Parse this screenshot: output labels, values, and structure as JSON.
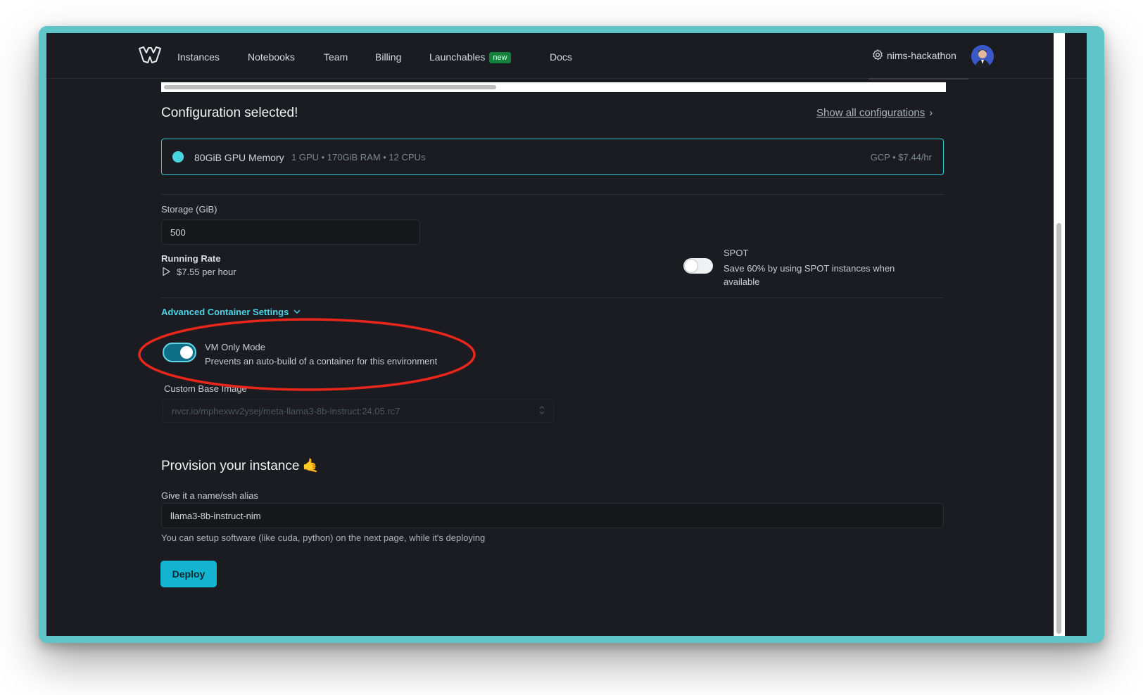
{
  "nav": {
    "items": [
      {
        "label": "Instances"
      },
      {
        "label": "Notebooks"
      },
      {
        "label": "Team"
      },
      {
        "label": "Billing"
      },
      {
        "label": "Launchables",
        "badge": "new"
      },
      {
        "label": "Docs"
      }
    ],
    "org_name": "nims-hackathon",
    "icons": {
      "logo": "brev-logo-icon",
      "settings": "gear-icon",
      "avatar": "user-avatar"
    }
  },
  "config": {
    "heading": "Configuration selected!",
    "show_all_link": "Show all configurations",
    "card": {
      "gpu": "80GiB GPU Memory",
      "specs": "1 GPU  • 170GiB RAM  • 12 CPUs",
      "price": "GCP  •  $7.44/hr"
    }
  },
  "storage": {
    "label": "Storage (GiB)",
    "value": "500"
  },
  "running_rate": {
    "label": "Running Rate",
    "value": "$7.55 per hour"
  },
  "spot": {
    "title": "SPOT",
    "description": "Save 60% by using SPOT instances when available",
    "enabled": false
  },
  "advanced": {
    "label": "Advanced Container Settings",
    "vm_only": {
      "title": "VM Only Mode",
      "description": "Prevents an auto-build of a container for this environment",
      "enabled": true
    },
    "custom_base_image": {
      "label": "Custom Base Image",
      "value": "nvcr.io/mphexwv2ysej/meta-llama3-8b-instruct:24.05.rc7"
    }
  },
  "provision": {
    "heading": "Provision your instance",
    "emoji": "🤙",
    "alias_label": "Give it a name/ssh alias",
    "alias_value": "llama3-8b-instruct-nim",
    "help_text": "You can setup software (like cuda, python) on the next page, while it's deploying",
    "deploy_label": "Deploy"
  },
  "colors": {
    "accent": "#14b3d0",
    "link": "#4fd2e6",
    "annotation": "#e8261b",
    "background": "#1a1c21",
    "frame": "#5fc5c8"
  }
}
